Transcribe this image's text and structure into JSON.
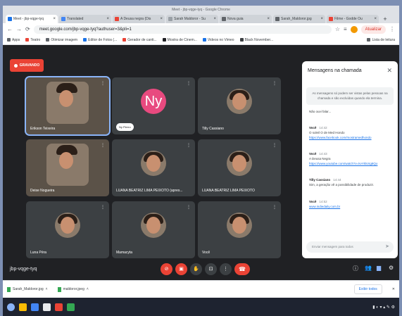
{
  "window_title": "Meet - jbp-vqge-tyq - Google Chrome",
  "tabs": [
    {
      "label": "Meet - jbp-vqge-tyq",
      "color": "#1a73e8"
    },
    {
      "label": "Translated",
      "color": "#4285f4"
    },
    {
      "label": "A Deusa negra (Dis",
      "color": "#ea4335"
    },
    {
      "label": "Sarah Maldoror - Su",
      "color": "#9aa0a6"
    },
    {
      "label": "Nova guia",
      "color": "#5f6368"
    },
    {
      "label": "Sarah_Maldoror.jpg",
      "color": "#5f6368"
    },
    {
      "label": "Filme - Godde Ou",
      "color": "#ea4335"
    }
  ],
  "new_tab": "+",
  "address": {
    "url": "meet.google.com/jbp-vqge-tyq?authuser=3&pli=1",
    "update_label": "Atualizar"
  },
  "bookmarks": [
    {
      "label": "Apps",
      "color": "#5f6368"
    },
    {
      "label": "Teatro",
      "color": "#ea4335"
    },
    {
      "label": "Otimizar imagem",
      "color": "#5f6368"
    },
    {
      "label": "Editor de Fotos (...",
      "color": "#1a73e8"
    },
    {
      "label": "Gerador de canti...",
      "color": "#ea4335"
    },
    {
      "label": "Mostra de Cinem...",
      "color": "#202124"
    },
    {
      "label": "Videos no Vimeo",
      "color": "#1a73e8"
    },
    {
      "label": "Black November...",
      "color": "#3c4043"
    },
    {
      "label": "Lista de leitura",
      "color": "#5f6368"
    }
  ],
  "recording_label": "GRAVANDO",
  "participants": [
    {
      "name": "Erikson Teixeira",
      "type": "video"
    },
    {
      "name": "Ny Pierro",
      "type": "initial",
      "initial": "Ny",
      "avatar_color": "#e84a7f"
    },
    {
      "name": "Tilly Cassiano",
      "type": "avatar"
    },
    {
      "name": "Deise Nogueira",
      "type": "video"
    },
    {
      "name": "LUANA BEATRIZ LIMA PEIXOTO (apres...",
      "type": "avatar"
    },
    {
      "name": "LUANA BEATRIZ LIMA PEIXOTO",
      "type": "avatar"
    },
    {
      "name": "Luna Péra",
      "type": "avatar"
    },
    {
      "name": "Mamacyta",
      "type": "avatar"
    },
    {
      "name": "Você",
      "type": "avatar"
    }
  ],
  "meeting_code": "jbp-vqge-tyq",
  "chat": {
    "title": "Mensagens na chamada",
    "notice": "As mensagens só podem ser vistas pelas pessoas na chamada e são excluídas quando ela termina.",
    "messages": [
      {
        "sender": "",
        "time": "",
        "text": "Não ouvi falar...",
        "link": ""
      },
      {
        "sender": "Você",
        "time": "14:42",
        "text": "O soleil O de Med Hondo",
        "link": "https://www.facebook.com/mostramedhondo"
      },
      {
        "sender": "Você",
        "time": "14:43",
        "text": "A Deusa Negra",
        "link": "https://www.youtube.com/watch?v=kvYklsXg8Qo"
      },
      {
        "sender": "Tilly Cassiano",
        "time": "14:44",
        "text": "Sim, a geração vê a possibilidade de produzir.",
        "link": ""
      },
      {
        "sender": "Você",
        "time": "14:52",
        "text": "",
        "link": "www.indiedaily.com.br"
      }
    ],
    "input_placeholder": "Enviar mensagem para todos"
  },
  "downloads": [
    {
      "label": "Sarah_Maldoror.jpg"
    },
    {
      "label": "maldoror.jpeg"
    }
  ],
  "show_all": "Exibir todos"
}
